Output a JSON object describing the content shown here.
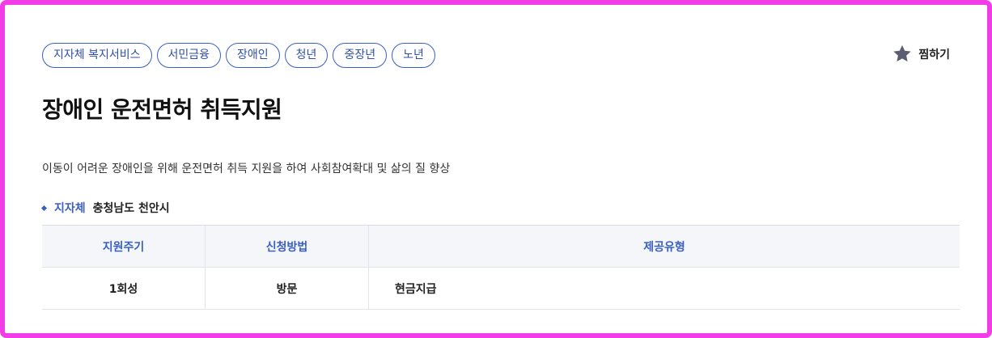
{
  "tags": [
    "지자체 복지서비스",
    "서민금융",
    "장애인",
    "청년",
    "중장년",
    "노년"
  ],
  "favorite": {
    "label": "찜하기",
    "icon": "star-icon"
  },
  "title": "장애인 운전면허 취득지원",
  "description": "이동이 어려운 장애인을 위해 운전면허 취득 지원을 하여 사회참여확대 및 삶의 질 향상",
  "region": {
    "label": "지자체",
    "value": "충청남도 천안시"
  },
  "table": {
    "headers": [
      "지원주기",
      "신청방법",
      "제공유형"
    ],
    "row": [
      "1회성",
      "방문",
      "현금지급"
    ]
  },
  "colors": {
    "accent": "#3a5fc0",
    "frame": "#f23ce8",
    "star": "#5b5e72"
  }
}
